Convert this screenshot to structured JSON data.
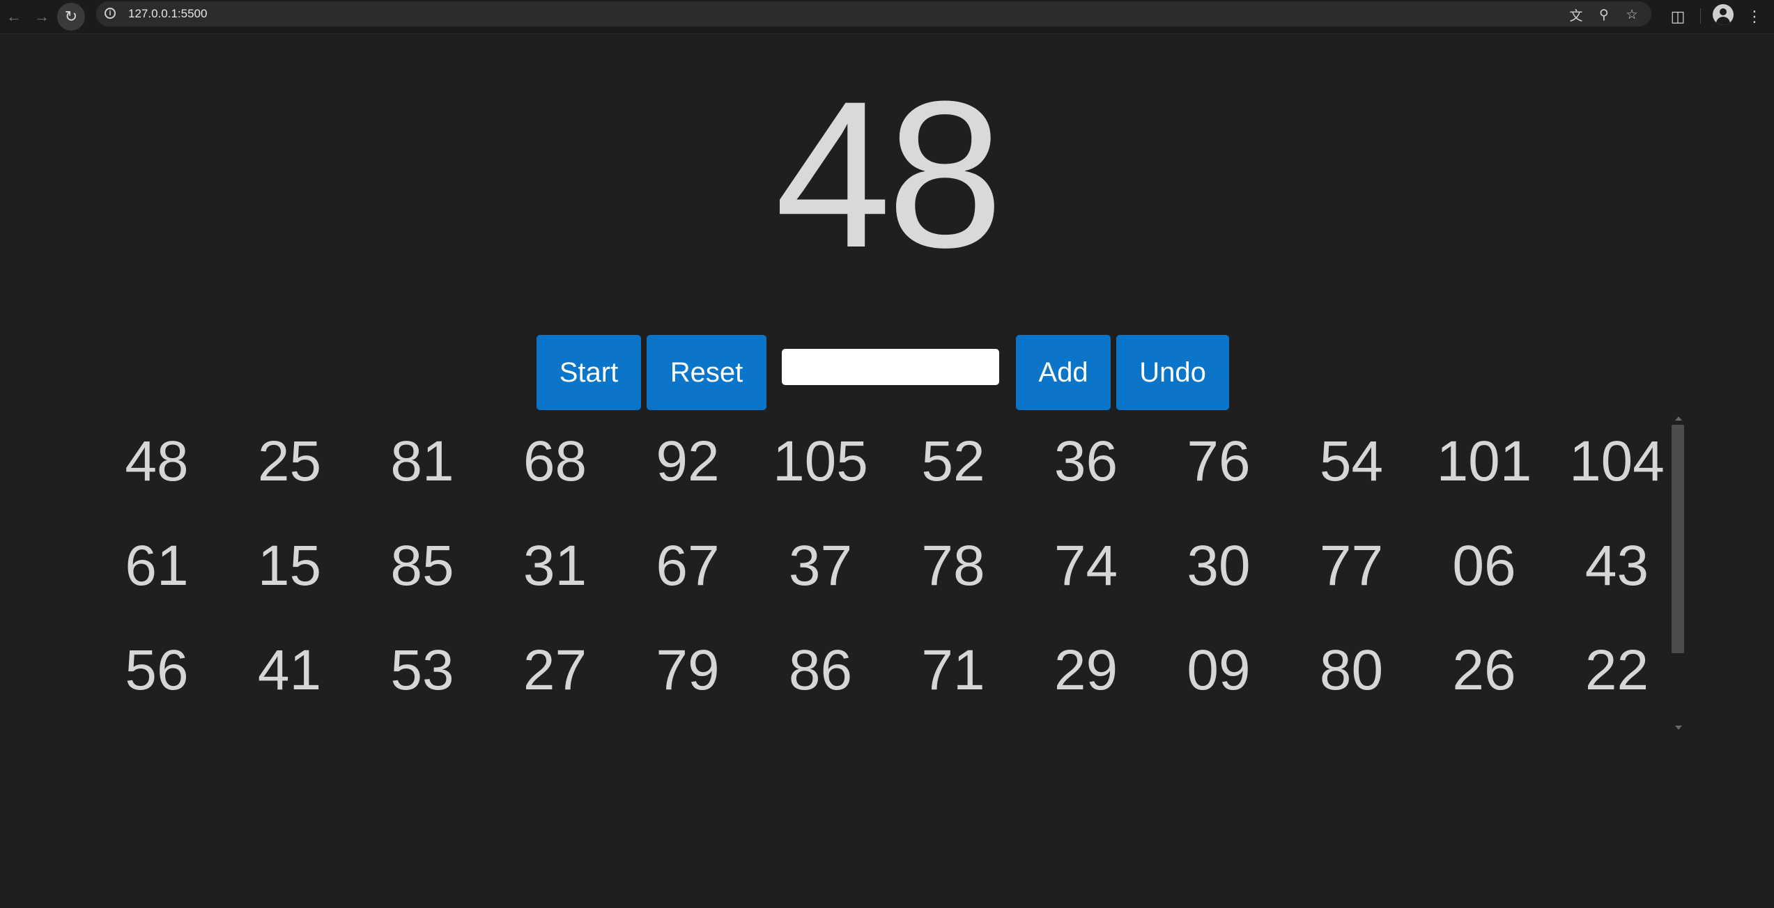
{
  "browser": {
    "url": "127.0.0.1:5500",
    "icons": {
      "back": "arrow-left-icon",
      "forward": "arrow-right-icon",
      "reload": "reload-icon",
      "info": "info-icon",
      "translate": "translate-icon",
      "zoom": "zoom-icon",
      "bookmark": "star-icon",
      "extensions": "puzzle-icon",
      "profile": "profile-icon",
      "menu": "kebab-menu-icon"
    }
  },
  "current_number": "48",
  "controls": {
    "start_label": "Start",
    "reset_label": "Reset",
    "input_value": "",
    "input_placeholder": "",
    "add_label": "Add",
    "undo_label": "Undo"
  },
  "colors": {
    "background": "#1f1f1f",
    "button": "#0a75c9",
    "text": "#d6d6d6"
  },
  "numbers": [
    [
      "48",
      "25",
      "81",
      "68",
      "92",
      "105",
      "52",
      "36",
      "76",
      "54",
      "101",
      "104"
    ],
    [
      "61",
      "15",
      "85",
      "31",
      "67",
      "37",
      "78",
      "74",
      "30",
      "77",
      "06",
      "43"
    ],
    [
      "56",
      "41",
      "53",
      "27",
      "79",
      "86",
      "71",
      "29",
      "09",
      "80",
      "26",
      "22"
    ]
  ]
}
